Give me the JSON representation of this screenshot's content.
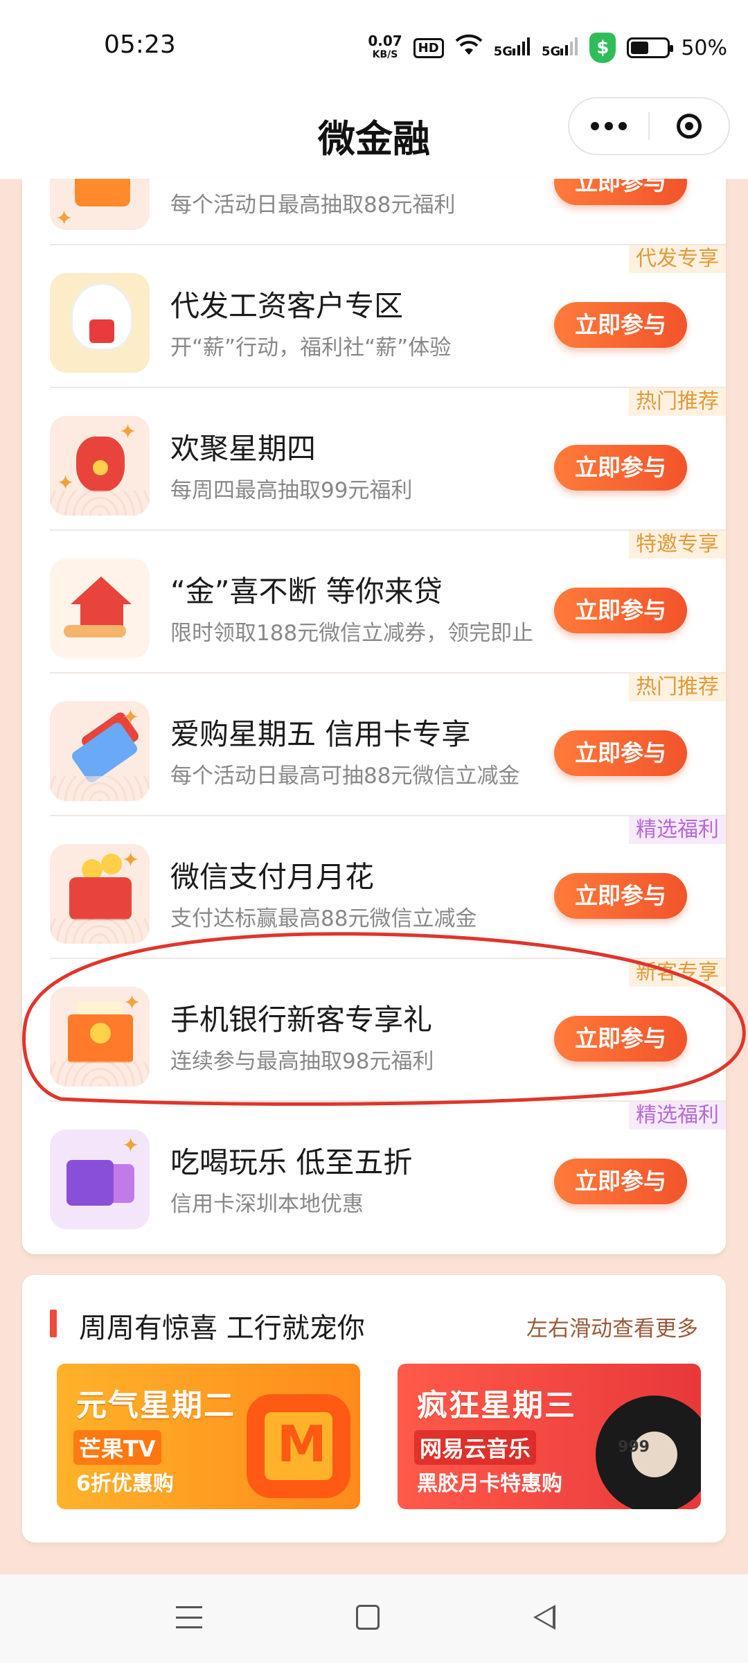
{
  "status_bar": {
    "time": "05:23",
    "net_speed_value": "0.07",
    "net_speed_unit": "KB/S",
    "hd": "HD",
    "sim1": "5G",
    "sim2": "5G",
    "security_icon": "$",
    "battery_percent": "50%",
    "battery_level": 0.5
  },
  "navbar": {
    "title": "微金融"
  },
  "activities": [
    {
      "tag": "",
      "title": "",
      "subtitle": "每个活动日最高抽取88元福利",
      "button": "立即参与",
      "icon": "orange-gift-icon"
    },
    {
      "tag": "代发专享",
      "title": "代发工资客户专区",
      "subtitle": "开“薪”行动，福利社“薪”体验",
      "button": "立即参与",
      "icon": "rabbit-mascot-icon"
    },
    {
      "tag": "热门推荐",
      "title": "欢聚星期四",
      "subtitle": "每周四最高抽取99元福利",
      "button": "立即参与",
      "icon": "money-bag-icon"
    },
    {
      "tag": "特邀专享",
      "title": "“金”喜不断 等你来贷",
      "subtitle": "限时领取188元微信立减券，领完即止",
      "button": "立即参与",
      "icon": "loan-house-icon"
    },
    {
      "tag": "热门推荐",
      "title": "爱购星期五 信用卡专享",
      "subtitle": "每个活动日最高可抽88元微信立减金",
      "button": "立即参与",
      "icon": "credit-card-icon"
    },
    {
      "tag": "精选福利",
      "title": "微信支付月月花",
      "subtitle": "支付达标赢最高88元微信立减金",
      "button": "立即参与",
      "icon": "wallet-icon"
    },
    {
      "tag": "新客专享",
      "title": "手机银行新客专享礼",
      "subtitle": "连续参与最高抽取98元福利",
      "button": "立即参与",
      "icon": "red-envelope-icon"
    },
    {
      "tag": "精选福利",
      "title": "吃喝玩乐 低至五折",
      "subtitle": "信用卡深圳本地优惠",
      "button": "立即参与",
      "icon": "shopping-bag-icon"
    }
  ],
  "promo": {
    "title": "周周有惊喜 工行就宠你",
    "more": "左右滑动查看更多",
    "banners": [
      {
        "head": "元气星期二",
        "tag": "芒果TV",
        "sub": "6折优惠购"
      },
      {
        "head": "疯狂星期三",
        "tag": "网易云音乐",
        "sub": "黑胶月卡特惠购",
        "label": "999"
      }
    ]
  },
  "colors": {
    "accent": "#f2542b",
    "page_bg": "#fbe1d6",
    "tag_orange": "#e09b3a",
    "tag_purple": "#b56bd6",
    "annotation_red": "#e0352b"
  }
}
